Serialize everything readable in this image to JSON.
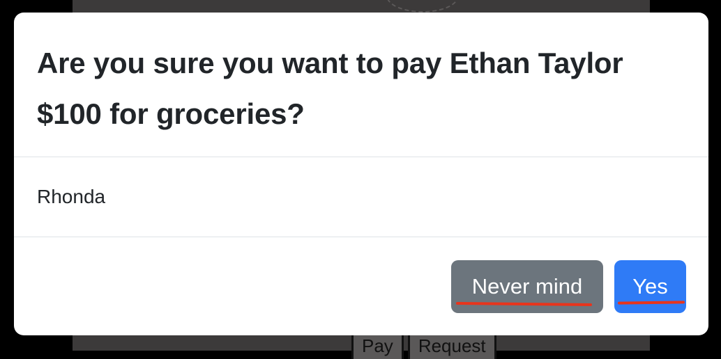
{
  "background": {
    "buttons": [
      "Pay",
      "Request"
    ]
  },
  "dialog": {
    "title": "Are you sure you want to pay Ethan Taylor $100 for groceries?",
    "body_text": "Rhonda",
    "cancel_label": "Never mind",
    "confirm_label": "Yes"
  },
  "colors": {
    "secondary": "#6c757d",
    "primary": "#2f7bf6",
    "annotation_underline": "#e8341c"
  }
}
